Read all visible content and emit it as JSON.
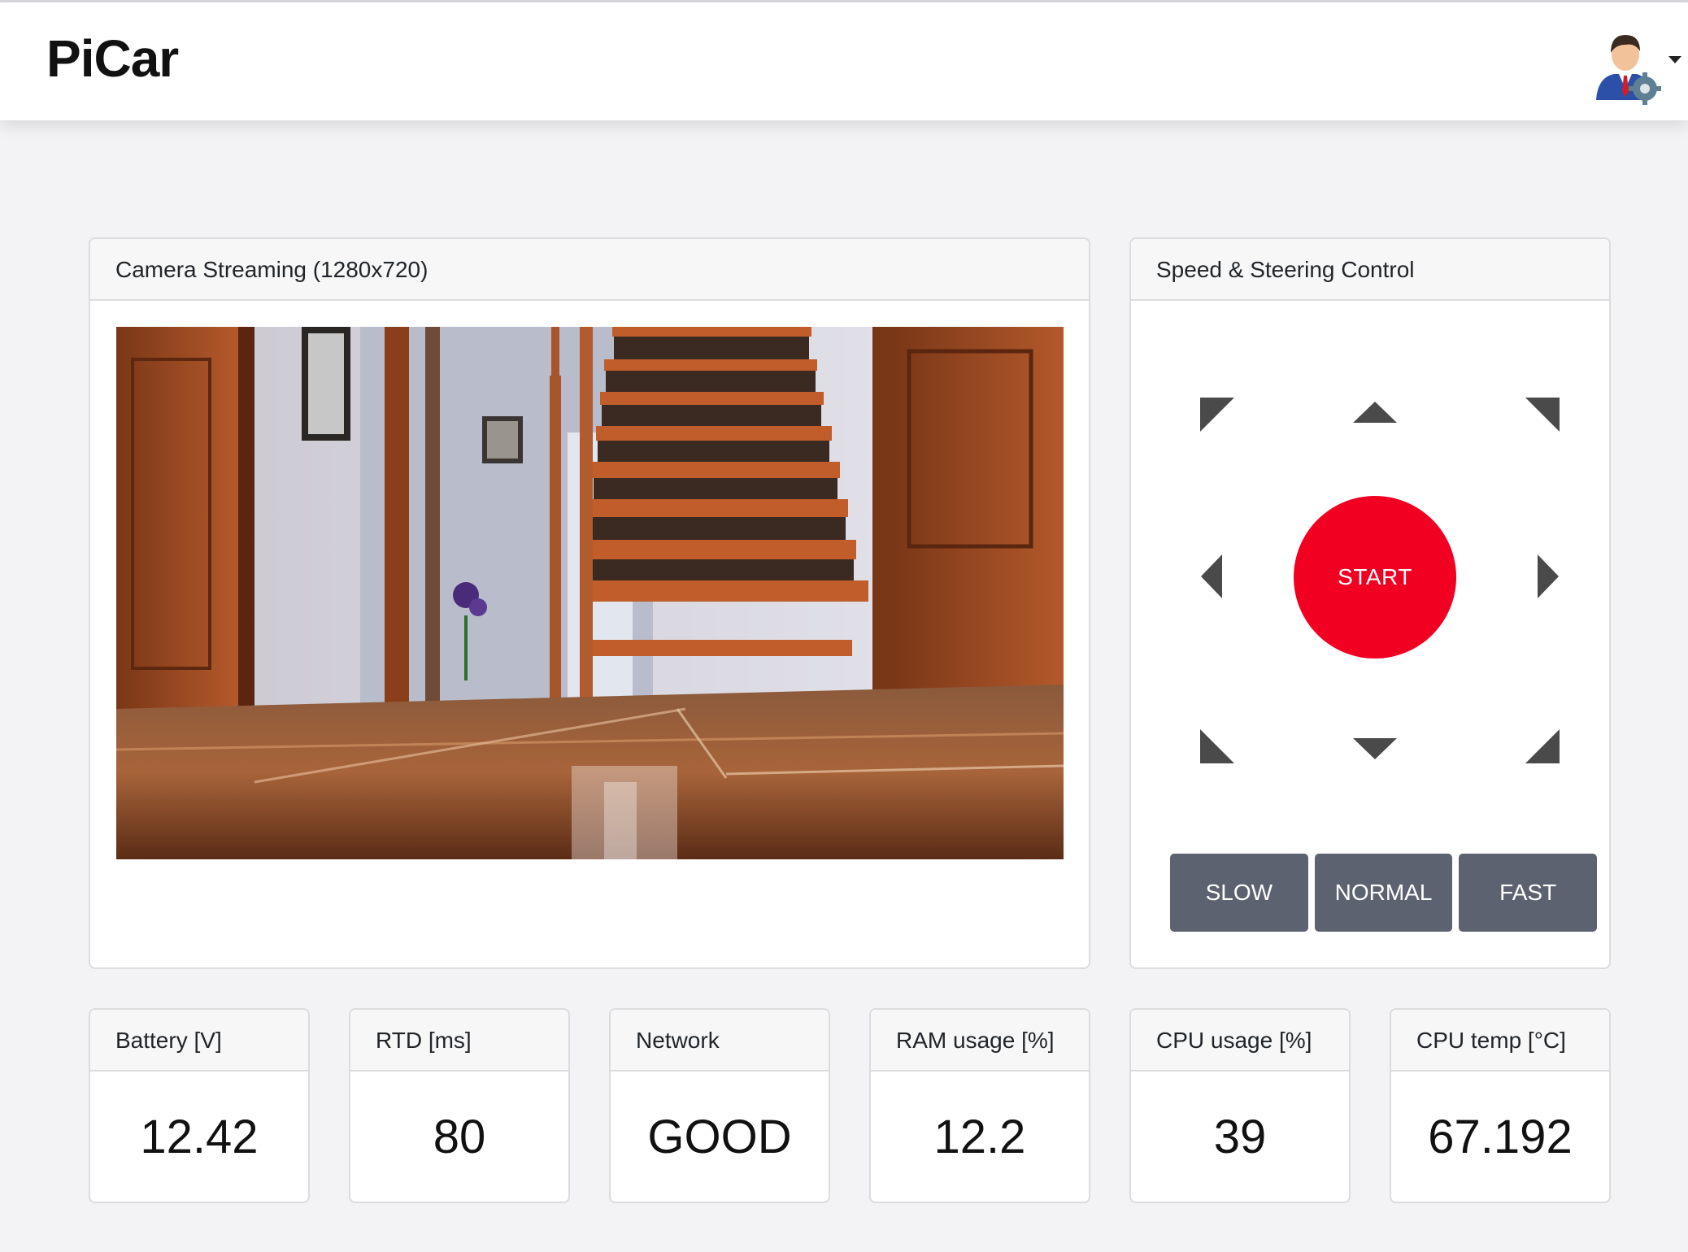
{
  "app": {
    "title": "PiCar"
  },
  "user_menu": {
    "avatar_icon": "user-settings-icon",
    "caret_icon": "caret-down-icon"
  },
  "camera": {
    "title": "Camera Streaming (1280x720)"
  },
  "control": {
    "title": "Speed & Steering Control",
    "start_label": "START",
    "start_color": "#f20022",
    "direction_icons": [
      "arrow-up-left-icon",
      "arrow-up-icon",
      "arrow-up-right-icon",
      "arrow-left-icon",
      "arrow-right-icon",
      "arrow-down-left-icon",
      "arrow-down-icon",
      "arrow-down-right-icon"
    ],
    "speeds": [
      "SLOW",
      "NORMAL",
      "FAST"
    ]
  },
  "stats": [
    {
      "label": "Battery [V]",
      "value": "12.42"
    },
    {
      "label": "RTD [ms]",
      "value": "80"
    },
    {
      "label": "Network",
      "value": "GOOD"
    },
    {
      "label": "RAM usage [%]",
      "value": "12.2"
    },
    {
      "label": "CPU usage [%]",
      "value": "39"
    },
    {
      "label": "CPU temp [°C]",
      "value": "67.192"
    }
  ]
}
